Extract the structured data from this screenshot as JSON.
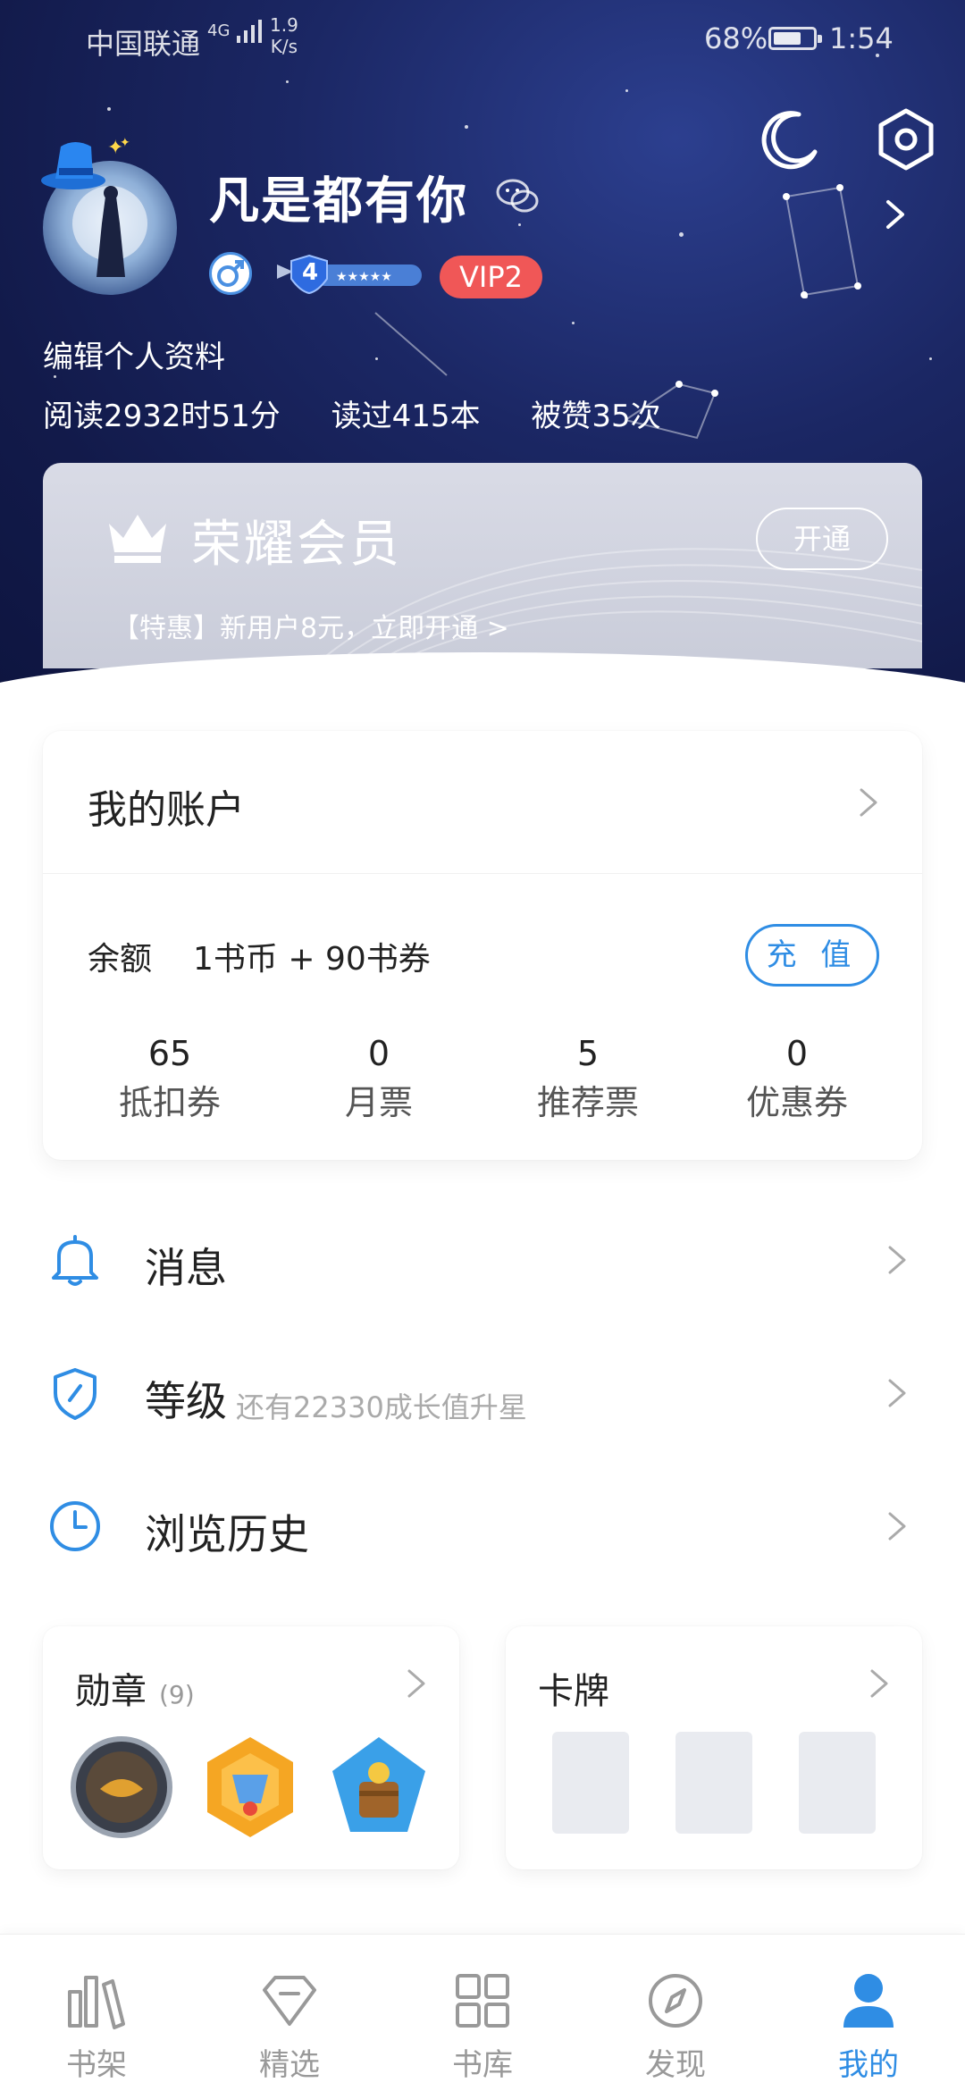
{
  "status_bar": {
    "carrier": "中国联通",
    "signal": "4G",
    "net_speed_value": "1.9",
    "net_speed_unit": "K/s",
    "battery": "68%",
    "time": "1:54"
  },
  "profile": {
    "username": "凡是都有你",
    "level": "4",
    "vip": "VIP2",
    "edit_label": "编辑个人资料",
    "stats": {
      "read_time": "阅读2932时51分",
      "books_read": "读过415本",
      "likes": "被赞35次"
    }
  },
  "vip_card": {
    "title": "荣耀会员",
    "button": "开通",
    "promo": "【特惠】新用户8元，立即开通 >"
  },
  "account": {
    "title": "我的账户",
    "balance_label": "余额",
    "balance_value": "1书币 + 90书券",
    "recharge": "充 值",
    "tickets": [
      {
        "num": "65",
        "label": "抵扣券"
      },
      {
        "num": "0",
        "label": "月票"
      },
      {
        "num": "5",
        "label": "推荐票"
      },
      {
        "num": "0",
        "label": "优惠券"
      }
    ]
  },
  "menu": {
    "messages": "消息",
    "level": "等级",
    "level_hint": "还有22330成长值升星",
    "history": "浏览历史"
  },
  "medals": {
    "title": "勋章",
    "count": "(9)"
  },
  "cards": {
    "title": "卡牌"
  },
  "tabs": [
    {
      "label": "书架"
    },
    {
      "label": "精选"
    },
    {
      "label": "书库"
    },
    {
      "label": "发现"
    },
    {
      "label": "我的"
    }
  ],
  "colors": {
    "accent": "#2f8de4",
    "vip_badge": "#f05757",
    "hero_bg": "#1b2764"
  }
}
